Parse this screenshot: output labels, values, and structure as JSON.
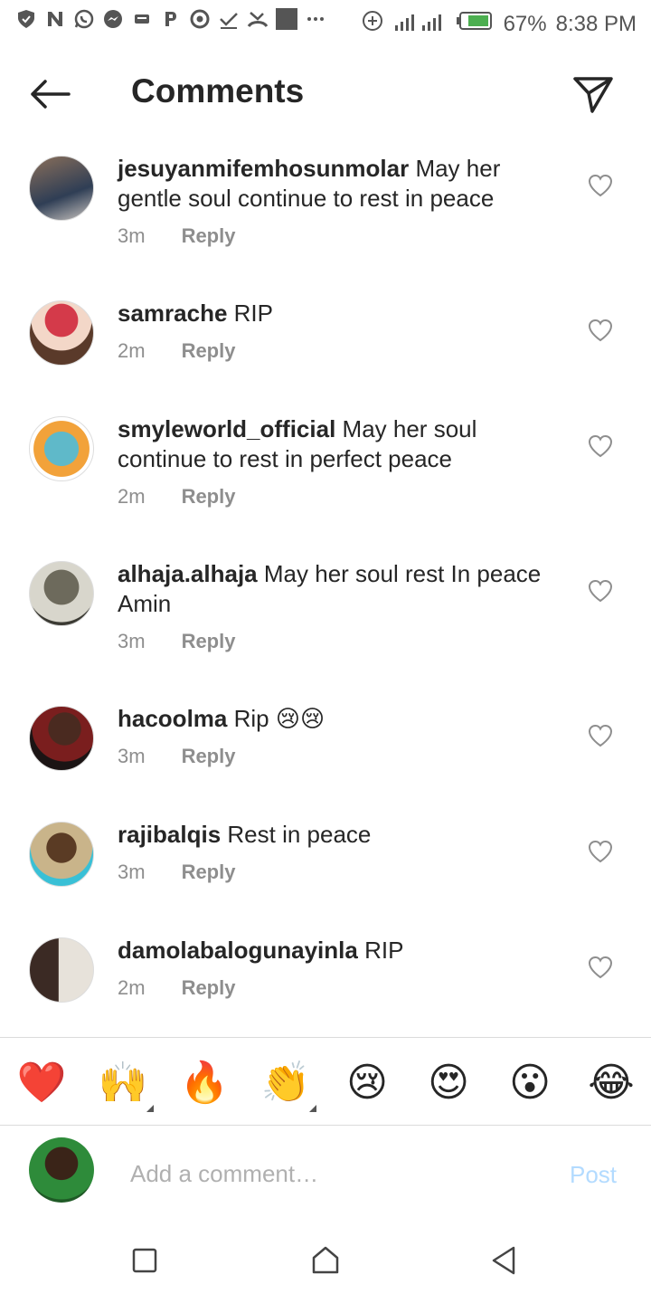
{
  "status_bar": {
    "icons": [
      "shield-icon",
      "n-icon",
      "whatsapp-icon",
      "messenger-icon",
      "message-icon",
      "p-icon",
      "chrome-icon",
      "check-icon",
      "missed-call-icon",
      "image-icon",
      "more-dots-icon"
    ],
    "battery": "67%",
    "time": "8:38 PM"
  },
  "header": {
    "title": "Comments"
  },
  "comments": [
    {
      "username": "jesuyanmifemhosunmolar",
      "text": "May her gentle soul continue to rest in peace",
      "time": "3m",
      "reply_label": "Reply"
    },
    {
      "username": "samrache",
      "text": "RIP",
      "time": "2m",
      "reply_label": "Reply"
    },
    {
      "username": "smyleworld_official",
      "text": "May her soul continue to rest in perfect peace",
      "time": "2m",
      "reply_label": "Reply"
    },
    {
      "username": "alhaja.alhaja",
      "text": "May her soul rest In peace Amin",
      "time": "3m",
      "reply_label": "Reply"
    },
    {
      "username": "hacoolma",
      "text": "Rip 😢😢",
      "time": "3m",
      "reply_label": "Reply"
    },
    {
      "username": "rajibalqis",
      "text": "Rest in peace",
      "time": "3m",
      "reply_label": "Reply"
    },
    {
      "username": "damolabalogunayinla",
      "text": "RIP",
      "time": "2m",
      "reply_label": "Reply"
    }
  ],
  "emoji_bar": [
    "❤️",
    "🙌",
    "🔥",
    "👏",
    "😢",
    "😍",
    "😮",
    "😂"
  ],
  "compose": {
    "placeholder": "Add a comment…",
    "post_label": "Post"
  },
  "colors": {
    "text": "#262626",
    "muted": "#8e8e8e",
    "post_disabled": "#b3dbff",
    "divider": "#dbdbdb"
  }
}
